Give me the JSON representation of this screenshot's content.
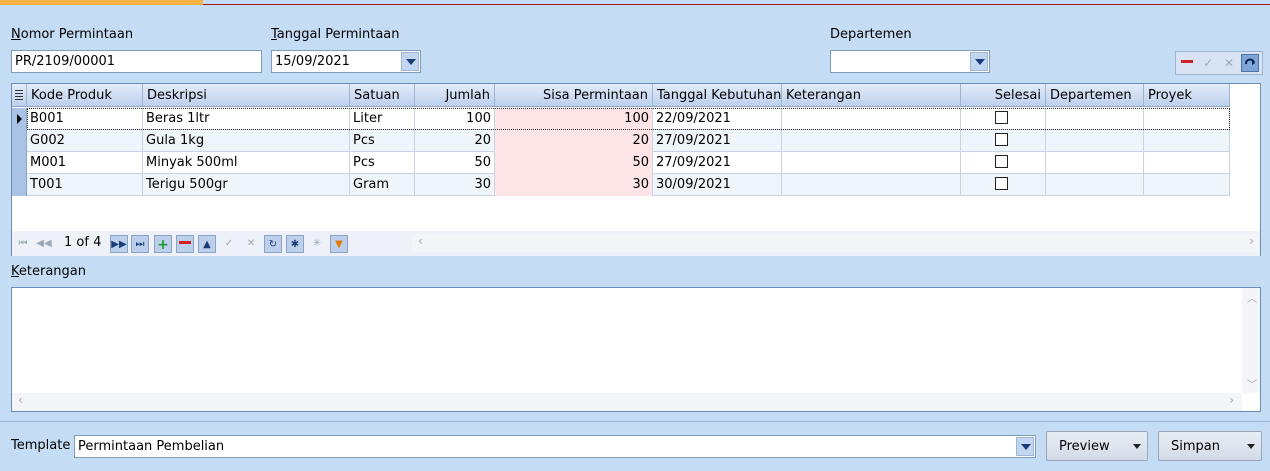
{
  "form": {
    "nomor_label_u": "N",
    "nomor_label_rest": "omor Permintaan",
    "nomor_value": "PR/2109/00001",
    "tanggal_label_u": "T",
    "tanggal_label_rest": "anggal Permintaan",
    "tanggal_value": "15/09/2021",
    "departemen_label": "Departemen",
    "departemen_value": ""
  },
  "grid": {
    "columns": [
      "Kode Produk",
      "Deskripsi",
      "Satuan",
      "Jumlah",
      "Sisa Permintaan",
      "Tanggal Kebutuhan",
      "Keterangan",
      "Selesai",
      "Departemen",
      "Proyek"
    ],
    "rows": [
      {
        "kode": "B001",
        "deskripsi": "Beras 1ltr",
        "satuan": "Liter",
        "jumlah": "100",
        "sisa": "100",
        "tanggal": "22/09/2021",
        "keterangan": "",
        "selesai": false
      },
      {
        "kode": "G002",
        "deskripsi": "Gula 1kg",
        "satuan": "Pcs",
        "jumlah": "20",
        "sisa": "20",
        "tanggal": "27/09/2021",
        "keterangan": "",
        "selesai": false
      },
      {
        "kode": "M001",
        "deskripsi": "Minyak 500ml",
        "satuan": "Pcs",
        "jumlah": "50",
        "sisa": "50",
        "tanggal": "27/09/2021",
        "keterangan": "",
        "selesai": false
      },
      {
        "kode": "T001",
        "deskripsi": "Terigu 500gr",
        "satuan": "Gram",
        "jumlah": "30",
        "sisa": "30",
        "tanggal": "30/09/2021",
        "keterangan": "",
        "selesai": false
      }
    ],
    "pager_text": "1 of 4"
  },
  "keterangan": {
    "label_u": "K",
    "label_rest": "eterangan",
    "value": ""
  },
  "footer": {
    "template_label": "Template",
    "template_value": "Permintaan Pembelian",
    "preview_label": "Preview",
    "simpan_label": "Simpan"
  },
  "colors": {
    "background": "#c5dcf5",
    "sisa_highlight": "#fde4e6",
    "alt_row": "#eef6fc",
    "accent_tab": "#f6b443"
  }
}
